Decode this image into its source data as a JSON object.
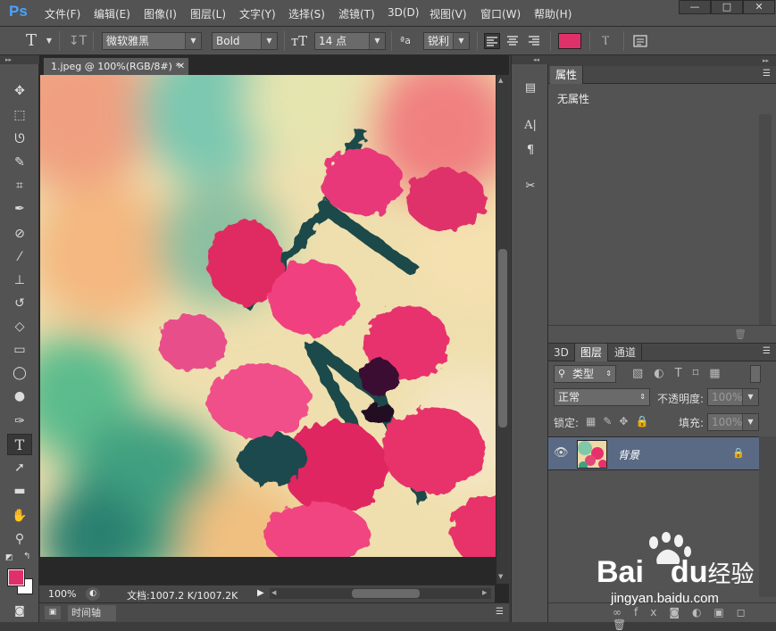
{
  "app": {
    "logo": "Ps"
  },
  "menu": [
    "文件(F)",
    "编辑(E)",
    "图像(I)",
    "图层(L)",
    "文字(Y)",
    "选择(S)",
    "滤镜(T)",
    "3D(D)",
    "视图(V)",
    "窗口(W)",
    "帮助(H)"
  ],
  "window_controls": {
    "minimize": "—",
    "restore": "□",
    "close": "✕"
  },
  "options": {
    "font_family": "微软雅黑",
    "font_style": "Bold",
    "font_size": "14 点",
    "aa_icon_label": "ªa",
    "anti_alias": "锐利",
    "color": "#e0306a"
  },
  "document": {
    "tab_title": "1.jpeg @ 100%(RGB/8#) *",
    "zoom": "100%",
    "doc_info": "文档:1007.2 K/1007.2K"
  },
  "timeline": {
    "label": "时间轴"
  },
  "properties": {
    "tab": "属性",
    "content": "无属性"
  },
  "layers_panel": {
    "tabs": [
      "3D",
      "图层",
      "通道"
    ],
    "filter_type": "类型",
    "blend_mode": "正常",
    "opacity_label": "不透明度:",
    "opacity_value": "100%",
    "lock_label": "锁定:",
    "fill_label": "填充:",
    "fill_value": "100%",
    "layer_name": "背景"
  },
  "colors": {
    "foreground": "#e0306a",
    "background": "#ffffff",
    "accent": "#4aa3ff",
    "selected_layer": "#5a6a84"
  },
  "watermark": {
    "brand": "Bai",
    "brand2": "du",
    "tagline": "经验",
    "url": "jingyan.baidu.com"
  }
}
